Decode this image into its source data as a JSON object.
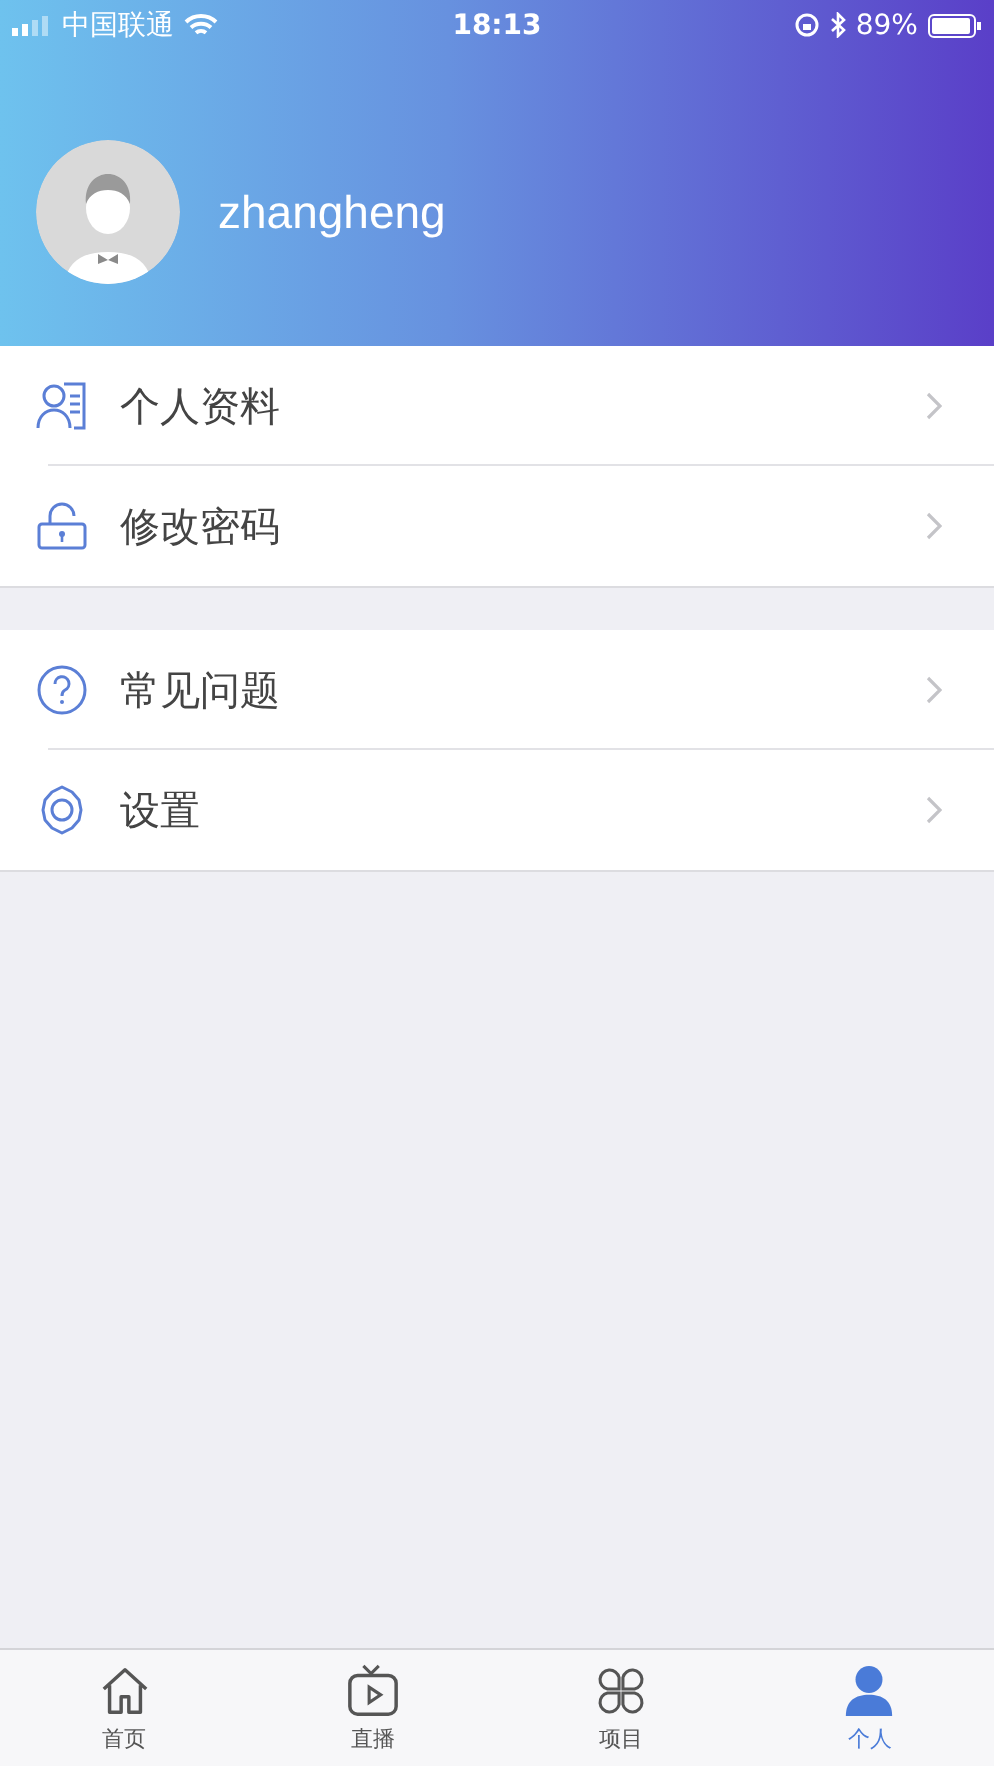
{
  "status_bar": {
    "carrier": "中国联通",
    "time": "18:13",
    "battery": "89%"
  },
  "profile": {
    "username": "zhangheng"
  },
  "menu_groups": [
    {
      "items": [
        {
          "kind": "profile",
          "label": "个人资料"
        },
        {
          "kind": "lock",
          "label": "修改密码"
        }
      ]
    },
    {
      "items": [
        {
          "kind": "help",
          "label": "常见问题"
        },
        {
          "kind": "settings",
          "label": "设置"
        }
      ]
    }
  ],
  "tab_bar": [
    {
      "kind": "home",
      "label": "首页",
      "selected": false
    },
    {
      "kind": "live",
      "label": "直播",
      "selected": false
    },
    {
      "kind": "projects",
      "label": "项目",
      "selected": false
    },
    {
      "kind": "me",
      "label": "个人",
      "selected": true
    }
  ]
}
